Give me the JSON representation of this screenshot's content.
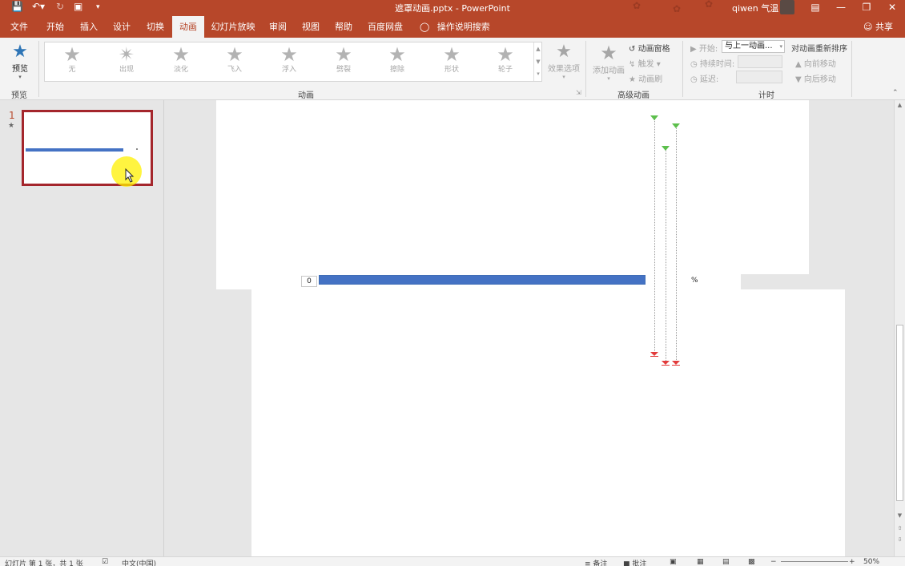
{
  "window": {
    "title": "遮罩动画.pptx  -  PowerPoint",
    "user": "qiwen 气温"
  },
  "tabs": {
    "file": "文件",
    "home": "开始",
    "insert": "插入",
    "design": "设计",
    "transitions": "切换",
    "animations": "动画",
    "slideshow": "幻灯片放映",
    "review": "审阅",
    "view": "视图",
    "help": "帮助",
    "baidu": "百度网盘",
    "tell_me": "操作说明搜索",
    "share": "共享"
  },
  "ribbon": {
    "preview_group": {
      "button": "预览",
      "label": "预览"
    },
    "animation_group": {
      "label": "动画",
      "gallery": [
        "无",
        "出现",
        "淡化",
        "飞入",
        "浮入",
        "劈裂",
        "擦除",
        "形状",
        "轮子"
      ],
      "effect_options": "效果选项"
    },
    "advanced_group": {
      "label": "高级动画",
      "add_animation": "添加动画",
      "animation_pane": "动画窗格",
      "trigger": "触发",
      "painter": "动画刷"
    },
    "timing_group": {
      "label": "计时",
      "start_label": "开始:",
      "start_value": "与上一动画...",
      "duration_label": "持续时间:",
      "delay_label": "延迟:",
      "reorder_title": "对动画重新排序",
      "move_earlier": "向前移动",
      "move_later": "向后移动"
    }
  },
  "thumbnails": {
    "slide_number": "1",
    "star": "★"
  },
  "slide": {
    "progress_label": "0",
    "progress_value": 1.0,
    "percent_sign": "%",
    "accent_color": "#4472c4"
  },
  "statusbar": {
    "slide_info": "幻灯片 第 1 张，共 1 张",
    "language": "中文(中国)",
    "notes": "备注",
    "comments": "批注",
    "zoom": "50%"
  },
  "colors": {
    "brand": "#b7472a",
    "ribbon_bg": "#f3f3f3"
  }
}
